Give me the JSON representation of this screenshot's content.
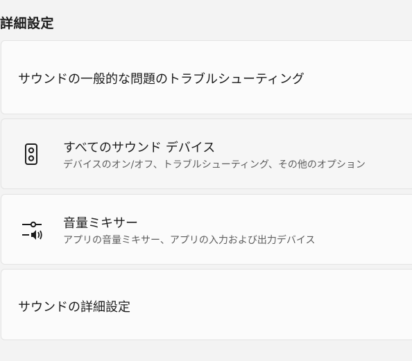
{
  "section": {
    "title": "詳細設定"
  },
  "items": [
    {
      "label": "サウンドの一般的な問題のトラブルシューティング"
    },
    {
      "title": "すべてのサウンド デバイス",
      "subtitle": "デバイスのオン/オフ、トラブルシューティング、その他のオプション",
      "icon": "speaker-icon"
    },
    {
      "title": "音量ミキサー",
      "subtitle": "アプリの音量ミキサー、アプリの入力および出力デバイス",
      "icon": "volume-mixer-icon"
    },
    {
      "label": "サウンドの詳細設定"
    }
  ]
}
